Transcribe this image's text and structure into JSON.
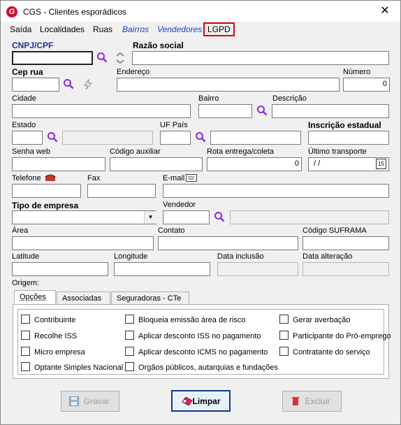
{
  "window": {
    "title": "CGS - Clientes esporádicos",
    "app_icon_letter": "G"
  },
  "menu": {
    "items": [
      "Saída",
      "Localidades",
      "Ruas",
      "Bairros",
      "Vendedores",
      "LGPD"
    ]
  },
  "labels": {
    "cnpj": "CNPJ/CPF",
    "razao_social": "Razão social",
    "cep_rua": "Cep rua",
    "endereco": "Endereço",
    "numero": "Número",
    "cidade": "Cidade",
    "bairro": "Bairro",
    "descricao": "Descrição",
    "estado": "Estado",
    "uf_pais": "UF País",
    "inscricao_estadual": "Inscrição estadual",
    "senha_web": "Senha web",
    "codigo_auxiliar": "Código auxiliar",
    "rota": "Rota entrega/coleta",
    "ultimo_transporte": "Último transporte",
    "telefone": "Telefone",
    "fax": "Fax",
    "email": "E-mail",
    "tipo_empresa": "Tipo de empresa",
    "vendedor": "Vendedor",
    "area": "Área",
    "contato": "Contato",
    "codigo_suframa": "Código SUFRAMA",
    "latitude": "Latitude",
    "longitude": "Longitude",
    "data_inclusao": "Data inclusão",
    "data_alteracao": "Data alteração",
    "origem": "Origem:"
  },
  "values": {
    "numero": "0",
    "rota": "0",
    "ultimo_transporte": "/ /",
    "calendar_day": "15"
  },
  "tabs": [
    "Opções",
    "Associadas",
    "Seguradoras - CTe"
  ],
  "options": {
    "col1": [
      "Contribuinte",
      "Recolhe ISS",
      "Micro empresa",
      "Optante Simples Nacional"
    ],
    "col2": [
      "Bloqueia emissão área de risco",
      "Aplicar desconto ISS no pagamento",
      "Aplicar desconto ICMS no pagamento",
      "Orgãos públicos, autarquias e fundações"
    ],
    "col3": [
      "Gerar averbação",
      "Participante do Pró-emprego",
      "Contratante do serviço"
    ]
  },
  "buttons": {
    "gravar": "Gravar",
    "limpar": "Limpar",
    "excluir": "Excluir"
  },
  "colors": {
    "accent_blue": "#1f3fd0",
    "lgpd_border": "#e00000",
    "search_icon": "#8a2be2"
  }
}
